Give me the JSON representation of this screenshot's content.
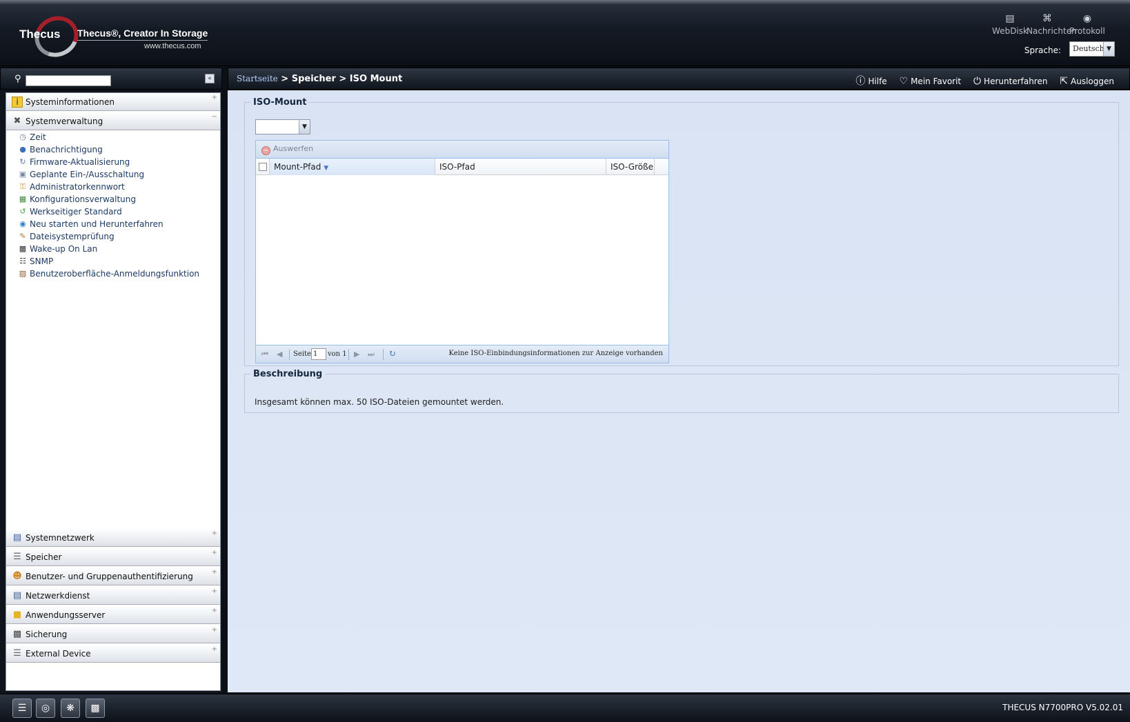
{
  "header": {
    "brand": "Thecus",
    "tagline": "Thecus®, Creator In Storage",
    "url": "www.thecus.com",
    "icons": [
      {
        "label": "WebDisk",
        "icon": "server-icon"
      },
      {
        "label": "Nachrichten",
        "icon": "rss-icon"
      },
      {
        "label": "Protokoll",
        "icon": "chat-icon"
      }
    ],
    "language_label": "Sprache:",
    "language_value": "Deutsch"
  },
  "sidebar": {
    "search_placeholder": "",
    "sections_top": [
      {
        "label": "Systeminformationen",
        "toggle": "+"
      },
      {
        "label": "Systemverwaltung",
        "toggle": "−"
      }
    ],
    "items": [
      {
        "label": "Zeit",
        "icon": "clock-icon"
      },
      {
        "label": "Benachrichtigung",
        "icon": "notification-icon"
      },
      {
        "label": "Firmware-Aktualisierung",
        "icon": "firmware-icon"
      },
      {
        "label": "Geplante Ein-/Ausschaltung",
        "icon": "schedule-icon"
      },
      {
        "label": "Administratorkennwort",
        "icon": "key-icon"
      },
      {
        "label": "Konfigurationsverwaltung",
        "icon": "config-icon"
      },
      {
        "label": "Werkseitiger Standard",
        "icon": "reset-icon"
      },
      {
        "label": "Neu starten und Herunterfahren",
        "icon": "power-icon"
      },
      {
        "label": "Dateisystemprüfung",
        "icon": "filesystem-icon"
      },
      {
        "label": "Wake-up On Lan",
        "icon": "wol-icon"
      },
      {
        "label": "SNMP",
        "icon": "snmp-icon"
      },
      {
        "label": "Benutzeroberfläche-Anmeldungsfunktion",
        "icon": "login-icon"
      }
    ],
    "sections_bottom": [
      {
        "label": "Systemnetzwerk",
        "toggle": "+"
      },
      {
        "label": "Speicher",
        "toggle": "+"
      },
      {
        "label": "Benutzer- und Gruppenauthentifizierung",
        "toggle": "+"
      },
      {
        "label": "Netzwerkdienst",
        "toggle": "+"
      },
      {
        "label": "Anwendungsserver",
        "toggle": "+"
      },
      {
        "label": "Sicherung",
        "toggle": "+"
      },
      {
        "label": "External Device",
        "toggle": "+"
      }
    ]
  },
  "breadcrumb": {
    "home": "Startseite",
    "path": " > Speicher > ISO Mount"
  },
  "toplinks": {
    "help": "Hilfe",
    "favorite": "Mein Favorit",
    "shutdown": "Herunterfahren",
    "logout": "Ausloggen"
  },
  "iso": {
    "legend": "ISO-Mount",
    "combo_value": "",
    "eject": "Auswerfen",
    "columns": {
      "mount": "Mount-Pfad",
      "iso": "ISO-Pfad",
      "size": "ISO-Größe"
    },
    "rows": [],
    "pager": {
      "page_label": "Seite",
      "page": "1",
      "of_label": "von 1"
    },
    "empty_message": "Keine ISO-Einbindungsinformationen zur Anzeige vorhanden"
  },
  "description": {
    "legend": "Beschreibung",
    "text": "Insgesamt können max. 50 ISO-Dateien gemountet werden."
  },
  "footer": {
    "version": "THECUS N7700PRO V5.02.01"
  }
}
